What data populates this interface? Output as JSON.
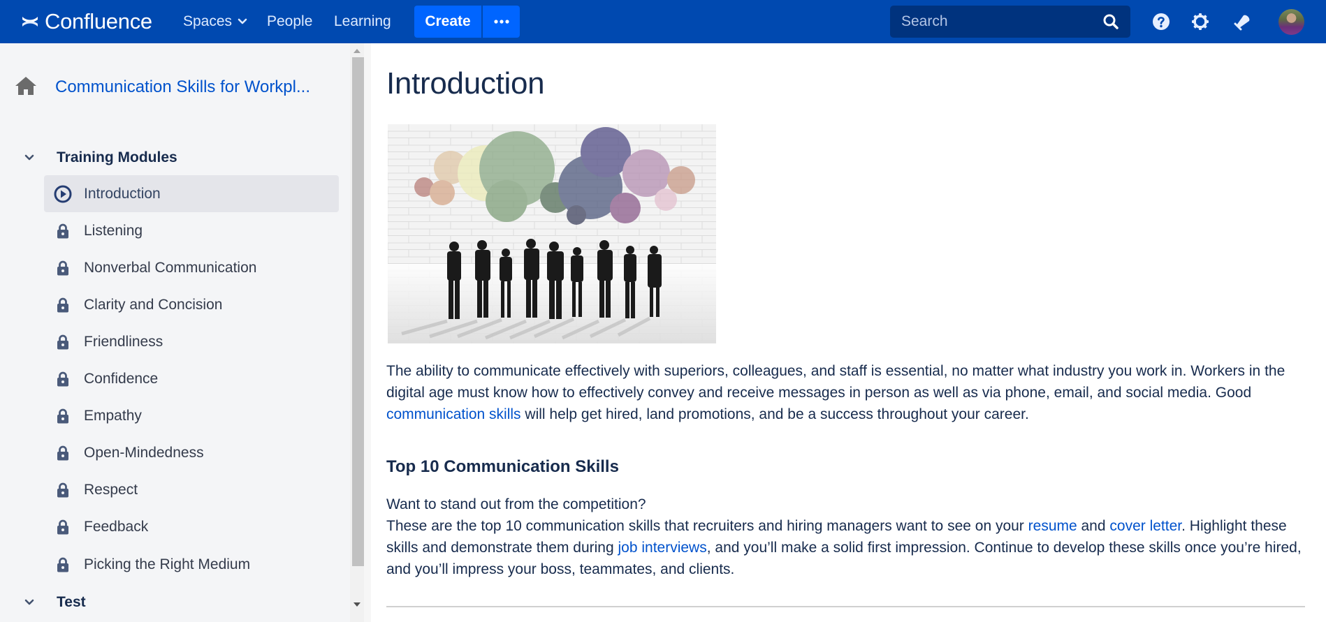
{
  "header": {
    "app_name": "Confluence",
    "nav": [
      {
        "label": "Spaces",
        "has_dropdown": true
      },
      {
        "label": "People"
      },
      {
        "label": "Learning"
      }
    ],
    "create_label": "Create",
    "more_icon": "ellipsis-icon",
    "search": {
      "placeholder": "Search",
      "value": ""
    },
    "icons": [
      "help-icon",
      "gear-icon",
      "notifications-icon"
    ],
    "avatar": "user-avatar"
  },
  "sidebar": {
    "space_title": "Communication Skills for Workpl...",
    "sections": [
      {
        "label": "Training Modules",
        "expanded": true,
        "items": [
          {
            "label": "Introduction",
            "icon": "play-circle-icon",
            "active": true
          },
          {
            "label": "Listening",
            "icon": "lock-icon"
          },
          {
            "label": "Nonverbal Communication",
            "icon": "lock-icon"
          },
          {
            "label": "Clarity and Concision",
            "icon": "lock-icon"
          },
          {
            "label": "Friendliness",
            "icon": "lock-icon"
          },
          {
            "label": "Confidence",
            "icon": "lock-icon"
          },
          {
            "label": "Empathy",
            "icon": "lock-icon"
          },
          {
            "label": "Open-Mindedness",
            "icon": "lock-icon"
          },
          {
            "label": "Respect",
            "icon": "lock-icon"
          },
          {
            "label": "Feedback",
            "icon": "lock-icon"
          },
          {
            "label": "Picking the Right Medium",
            "icon": "lock-icon"
          }
        ]
      },
      {
        "label": "Test",
        "expanded": true,
        "items": []
      }
    ]
  },
  "content": {
    "title": "Introduction",
    "image_alt": "Silhouettes of business people with colorful speech bubbles",
    "para1": {
      "before": "The ability to communicate effectively with superiors, colleagues, and staff is essential, no matter what industry you work in. Workers in the digital age must know how to effectively convey and receive messages in person as well as via phone, email, and social media. Good ",
      "link": "communication skills",
      "after": " will help get hired, land promotions, and be a success throughout your career."
    },
    "section_heading": "Top 10 Communication Skills",
    "para2": {
      "line1": "Want to stand out from the competition?",
      "text1": "These are the top 10 communication skills that recruiters and hiring managers want to see on your ",
      "link1": "resume",
      "text2": " and ",
      "link2": "cover letter",
      "text3": ". Highlight these skills and demonstrate them during ",
      "link3": "job interviews",
      "text4": ", and you’ll make a solid first impression. Continue to develop these skills once you’re hired, and you’ll impress your boss, teammates, and clients."
    }
  },
  "colors": {
    "header_bg": "#0049b0",
    "create_button": "#0065ff",
    "search_bg": "#00337e",
    "link": "#0052cc",
    "sidebar_bg": "#f4f5f7",
    "active_item_bg": "#e4e5ea",
    "icon_slate": "#4a5a7a"
  }
}
